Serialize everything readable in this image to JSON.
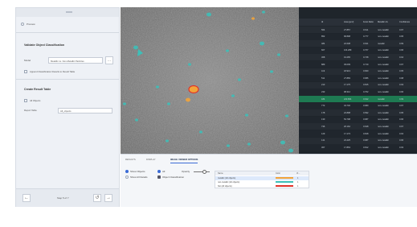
{
  "left_panel": {
    "preview_label": "Preview",
    "section1_title": "Validate Object Classification",
    "model_label": "Model",
    "model_value": "Metallic vs. Non-Metallic Particles",
    "model_button": "...",
    "append_label": "Append Classification Results to Result Table",
    "section2_title": "Create Result Table",
    "objects_label": "All Objects",
    "report_label": "Report Table",
    "report_value": "All_objects",
    "footer": {
      "prev": "←",
      "page_text": "Step 5 of 7",
      "undo": "↺",
      "next": "→"
    }
  },
  "table": {
    "columns": [
      "Id",
      "Area [µm²]",
      "Feret Ratio",
      "Metallic cls",
      "Confidence"
    ],
    "rows": [
      {
        "id": "564",
        "area": "27.857",
        "ratio": "0.611",
        "cls": "non-metallic",
        "conf": "0.97"
      },
      {
        "id": "852",
        "area": "68.898",
        "ratio": "0.777",
        "cls": "non-metallic",
        "conf": "0.95"
      },
      {
        "id": "484",
        "area": "22.638",
        "ratio": "0.621",
        "cls": "metallic",
        "conf": "0.99"
      },
      {
        "id": "607",
        "area": "104.289",
        "ratio": "0.707",
        "cls": "non-metallic",
        "conf": "0.96"
      },
      {
        "id": "368",
        "area": "19.265",
        "ratio": "0.748",
        "cls": "non-metallic",
        "conf": "0.94"
      },
      {
        "id": "889",
        "area": "39.009",
        "ratio": "0.719",
        "cls": "non-metallic",
        "conf": "0.97"
      },
      {
        "id": "119",
        "area": "18.913",
        "ratio": "0.660",
        "cls": "non-metallic",
        "conf": "0.95"
      },
      {
        "id": "511",
        "area": "27.883",
        "ratio": "0.686",
        "cls": "non-metallic",
        "conf": "0.98"
      },
      {
        "id": "213",
        "area": "17.175",
        "ratio": "0.815",
        "cls": "non-metallic",
        "conf": "0.93"
      },
      {
        "id": "233",
        "area": "98.312",
        "ratio": "0.702",
        "cls": "non-metallic",
        "conf": "0.96"
      },
      {
        "id": "184",
        "area": "223.864",
        "ratio": "0.642",
        "cls": "metallic",
        "conf": "0.99"
      },
      {
        "id": "772",
        "area": "34.740",
        "ratio": "0.680",
        "cls": "non-metallic",
        "conf": "0.97"
      },
      {
        "id": "178",
        "area": "22.898",
        "ratio": "0.692",
        "cls": "non-metallic",
        "conf": "0.95"
      },
      {
        "id": "130",
        "area": "53.798",
        "ratio": "0.687",
        "cls": "non-metallic",
        "conf": "0.96"
      },
      {
        "id": "736",
        "area": "26.162",
        "ratio": "0.628",
        "cls": "non-metallic",
        "conf": "0.97"
      },
      {
        "id": "129",
        "area": "17.173",
        "ratio": "0.818",
        "cls": "non-metallic",
        "conf": "0.94"
      },
      {
        "id": "141",
        "area": "24.425",
        "ratio": "0.687",
        "cls": "non-metallic",
        "conf": "0.96"
      },
      {
        "id": "367",
        "area": "17.863",
        "ratio": "0.812",
        "cls": "non-metallic",
        "conf": "0.93"
      }
    ],
    "highlighted_row": 10
  },
  "bottom_panel": {
    "tabs": [
      "RESULTS",
      "DISPLAY",
      "IMAGE VIEWER OPTIONS"
    ],
    "active_tab": 2,
    "options": {
      "show_objects": "Show Objects",
      "show_all_details": "Show All Details",
      "all_label": "All",
      "object_classification": "Object Classification",
      "opacity_label": "Opacity"
    },
    "legend": {
      "headers": [
        "Name",
        "Color",
        "Vi..."
      ],
      "rows": [
        {
          "name": "metallic (All objects)",
          "color": "#f2a43a",
          "visible": "1"
        },
        {
          "name": "non-metallic (All objects)",
          "color": "#3dbfb8",
          "visible": "1"
        },
        {
          "name": "Not (All objects)",
          "color": "#e0332a",
          "visible": "1"
        }
      ]
    }
  },
  "colors": {
    "accent": "#3b6bd6",
    "metallic": "#f2a43a",
    "non_metallic": "#3dbfb8",
    "highlight": "#1e7a52"
  }
}
